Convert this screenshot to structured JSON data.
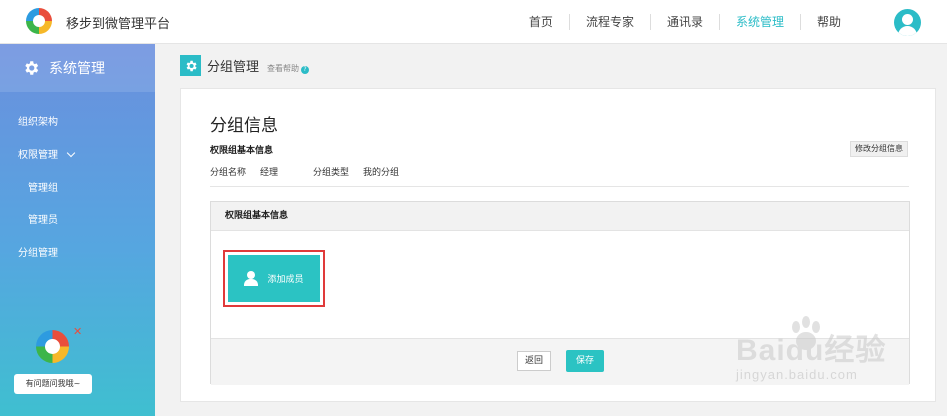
{
  "header": {
    "app_title": "移步到微管理平台",
    "nav": [
      {
        "label": "首页",
        "active": false
      },
      {
        "label": "流程专家",
        "active": false
      },
      {
        "label": "通讯录",
        "active": false
      },
      {
        "label": "系统管理",
        "active": true
      },
      {
        "label": "帮助",
        "active": false
      }
    ],
    "accent_color": "#2bbcc7"
  },
  "sidebar": {
    "title": "系统管理",
    "items": [
      {
        "label": "组织架构"
      },
      {
        "label": "权限管理"
      },
      {
        "label": "管理组"
      },
      {
        "label": "管理员"
      },
      {
        "label": "分组管理"
      }
    ],
    "help_bubble": "有问题问我哦~",
    "close_glyph": "✕"
  },
  "page": {
    "title": "分组管理",
    "help_link": "查看帮助",
    "help_glyph": "?"
  },
  "group_info": {
    "title": "分组信息",
    "basic_label": "权限组基本信息",
    "edit_button": "修改分组信息",
    "name_label": "分组名称",
    "name_value": "经理",
    "type_label": "分组类型",
    "type_value": "我的分组"
  },
  "permission": {
    "header": "权限组基本信息",
    "add_member_button": "添加成员",
    "back_button": "返回",
    "save_button": "保存"
  },
  "watermark": {
    "brand": "Baidu经验",
    "url": "jingyan.baidu.com"
  }
}
